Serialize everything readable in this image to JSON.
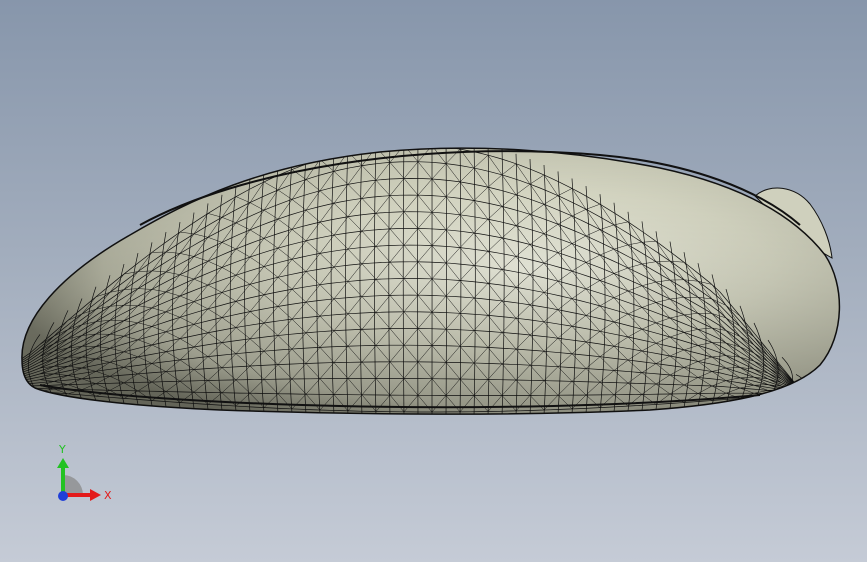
{
  "viewport": {
    "triad": {
      "x_label": "X",
      "y_label": "Y",
      "x_color": "#e31a1a",
      "y_color": "#22c222",
      "z_color": "#1f3fd8"
    },
    "model": {
      "description_icon": "mouse-shell-wireframe",
      "surface_color": "#e9ead8",
      "edge_color": "#111111"
    }
  }
}
